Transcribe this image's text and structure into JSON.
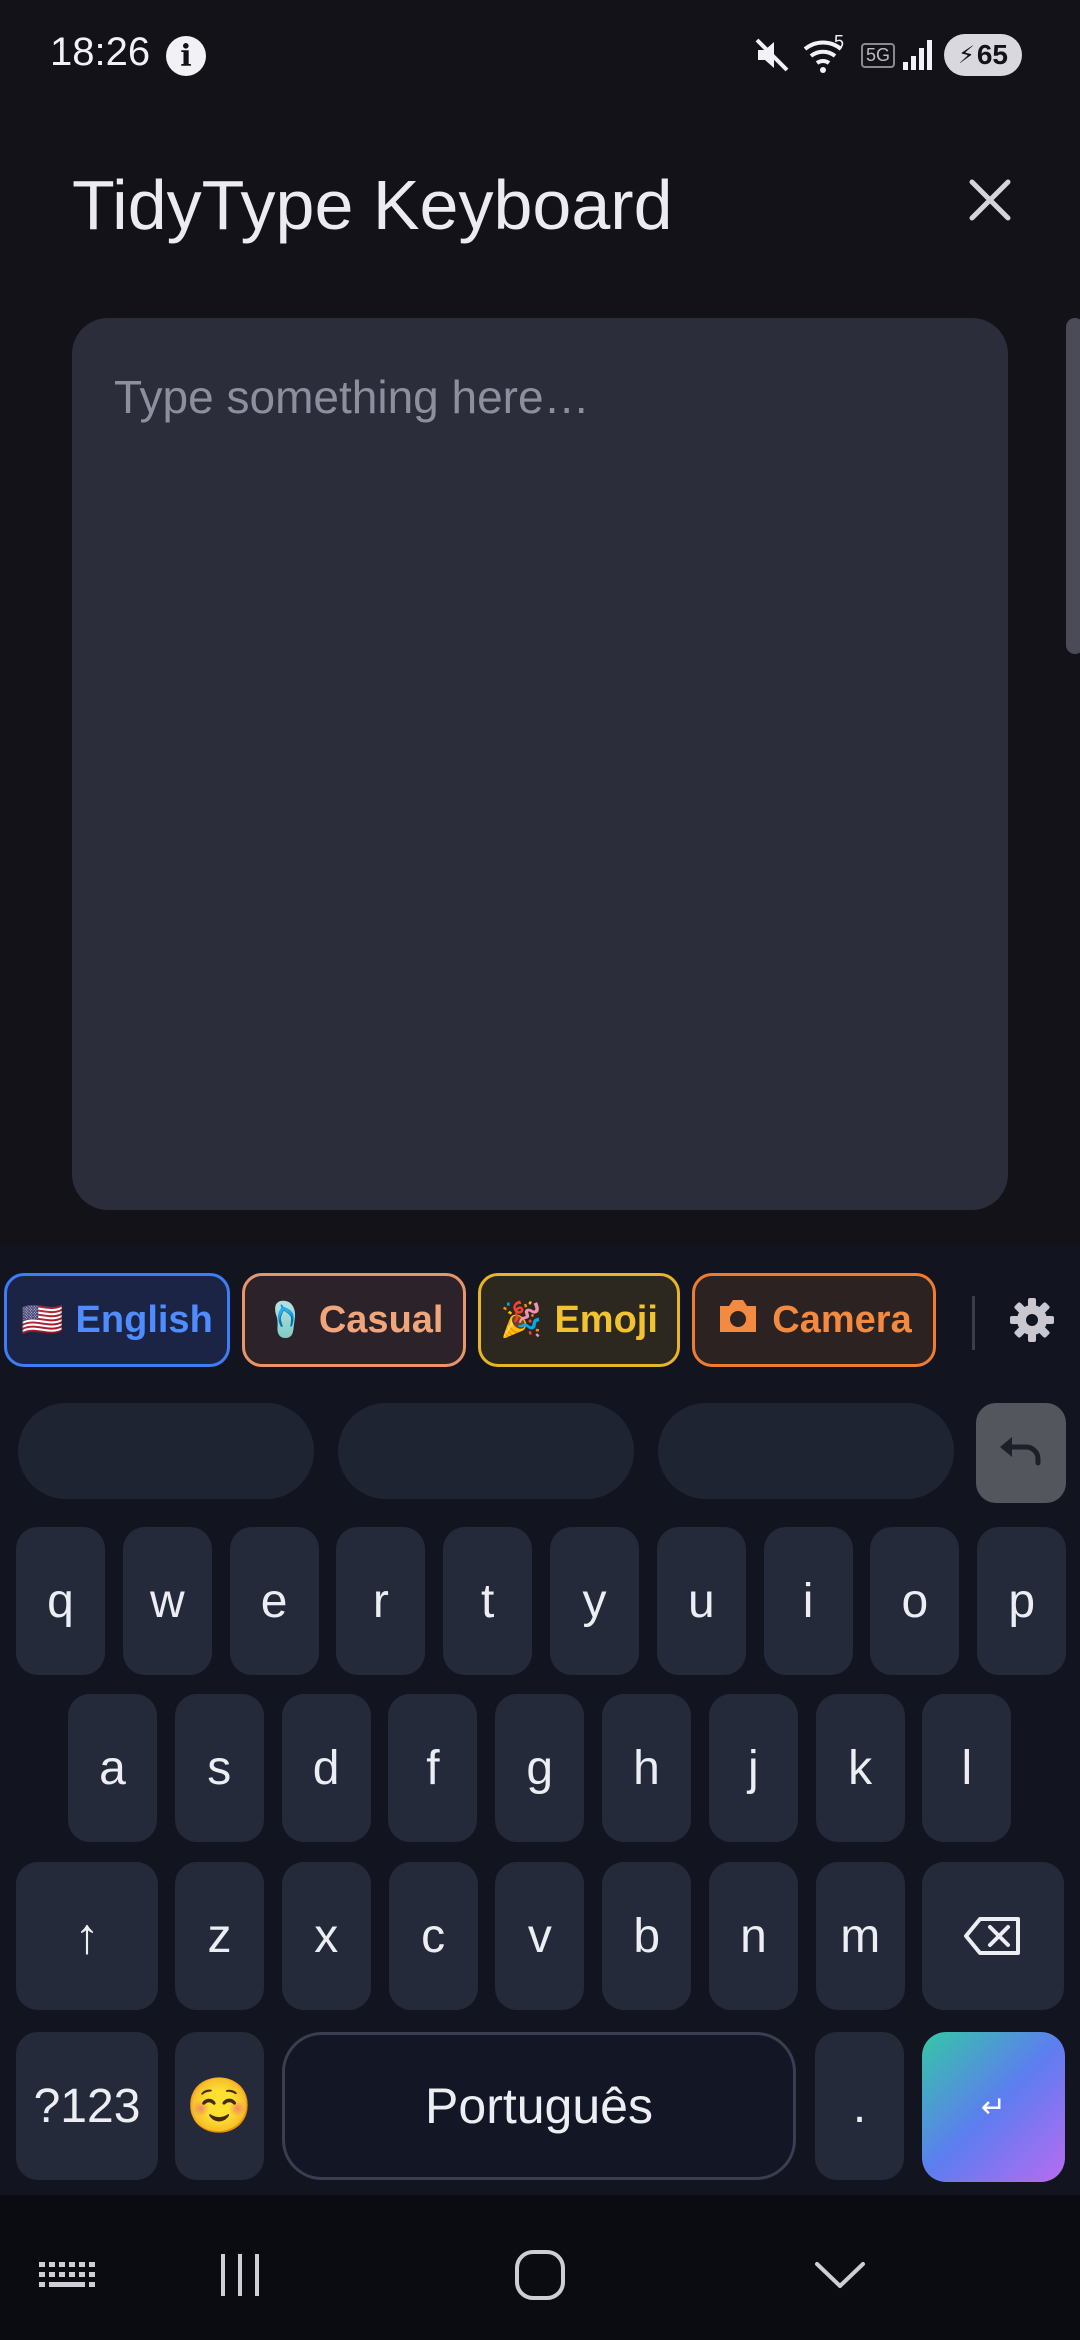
{
  "status_bar": {
    "time": "18:26",
    "network_label": "5G",
    "wifi_badge": "5",
    "battery_level": "65",
    "icons": [
      "info-icon",
      "mute-icon",
      "wifi-icon",
      "signal-icon",
      "battery-charging-icon"
    ]
  },
  "header": {
    "title": "TidyType Keyboard",
    "close_icon": "close-icon"
  },
  "editor": {
    "placeholder": "Type something here…",
    "value": ""
  },
  "keyboard": {
    "mode_pills": [
      {
        "label": "English",
        "icon": "🇺🇸",
        "icon_name": "us-flag-icon"
      },
      {
        "label": "Casual",
        "icon": "🩴",
        "icon_name": "flip-flop-icon"
      },
      {
        "label": "Emoji",
        "icon": "🎉",
        "icon_name": "party-popper-icon"
      },
      {
        "label": "Camera",
        "icon": "📷",
        "icon_name": "camera-icon"
      }
    ],
    "settings_icon": "gear-icon",
    "undo_icon": "undo-icon",
    "rows": [
      [
        "q",
        "w",
        "e",
        "r",
        "t",
        "y",
        "u",
        "i",
        "o",
        "p"
      ],
      [
        "a",
        "s",
        "d",
        "f",
        "g",
        "h",
        "j",
        "k",
        "l"
      ],
      [
        "z",
        "x",
        "c",
        "v",
        "b",
        "n",
        "m"
      ]
    ],
    "shift_label": "↑",
    "backspace_icon": "backspace-icon",
    "symbols_label": "?123",
    "emoji_label": "☺️",
    "space_label": "Português",
    "period_label": ".",
    "enter_label": "↵",
    "colors": {
      "english": "#3d7df5",
      "casual": "#e8956a",
      "emoji": "#e8b524",
      "camera": "#ef7c2f"
    }
  },
  "nav_bar": {
    "icons": [
      "keyboard-hide-icon",
      "recents-icon",
      "home-icon",
      "back-chevron-icon"
    ]
  }
}
